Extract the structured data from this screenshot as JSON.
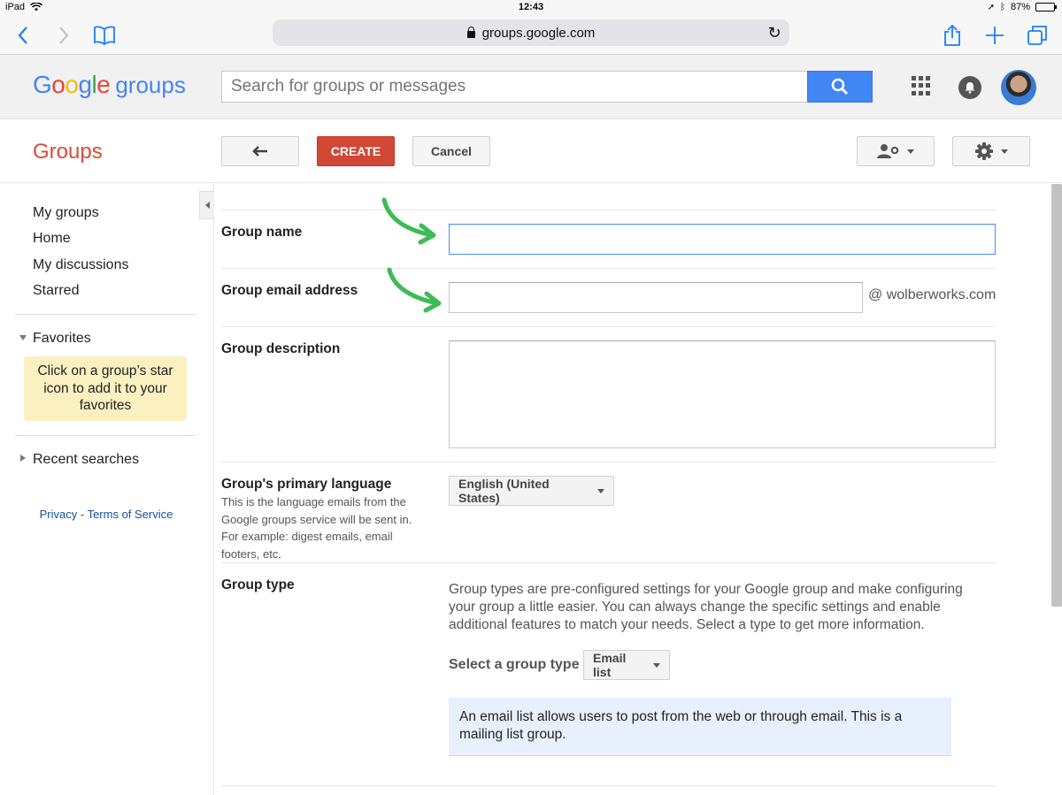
{
  "status_bar": {
    "device": "iPad",
    "time": "12:43",
    "battery": "87%",
    "battery_level": 0.87
  },
  "browser": {
    "url": "groups.google.com"
  },
  "header": {
    "logo_google": [
      "G",
      "o",
      "o",
      "g",
      "l",
      "e"
    ],
    "logo_product": "groups",
    "search_placeholder": "Search for groups or messages"
  },
  "toolbar": {
    "section_title": "Groups",
    "create_label": "CREATE",
    "cancel_label": "Cancel"
  },
  "sidebar": {
    "items": [
      "My groups",
      "Home",
      "My discussions",
      "Starred"
    ],
    "favorites_label": "Favorites",
    "favorites_tip": "Click on a group’s star icon to add it to your favorites",
    "recent_label": "Recent searches",
    "privacy_label": "Privacy",
    "links_separator": "-",
    "terms_label": "Terms of Service"
  },
  "form": {
    "group_name_label": "Group name",
    "group_name_value": "",
    "email_label": "Group email address",
    "email_value": "",
    "email_domain": "@ wolberworks.com",
    "description_label": "Group description",
    "description_value": "",
    "language_label": "Group's primary language",
    "language_hint": "This is the language emails from the Google groups service will be sent in. For example: digest emails, email footers, etc.",
    "language_value": "English (United States)",
    "type_label": "Group type",
    "type_description": "Group types are pre-configured settings for your Google group and make configuring your group a little easier. You can always change the specific settings and enable additional features to match your needs. Select a type to get more information.",
    "select_type_label": "Select a group type",
    "type_value": "Email list",
    "type_info": "An email list allows users to post from the web or through email. This is a mailing list group."
  }
}
